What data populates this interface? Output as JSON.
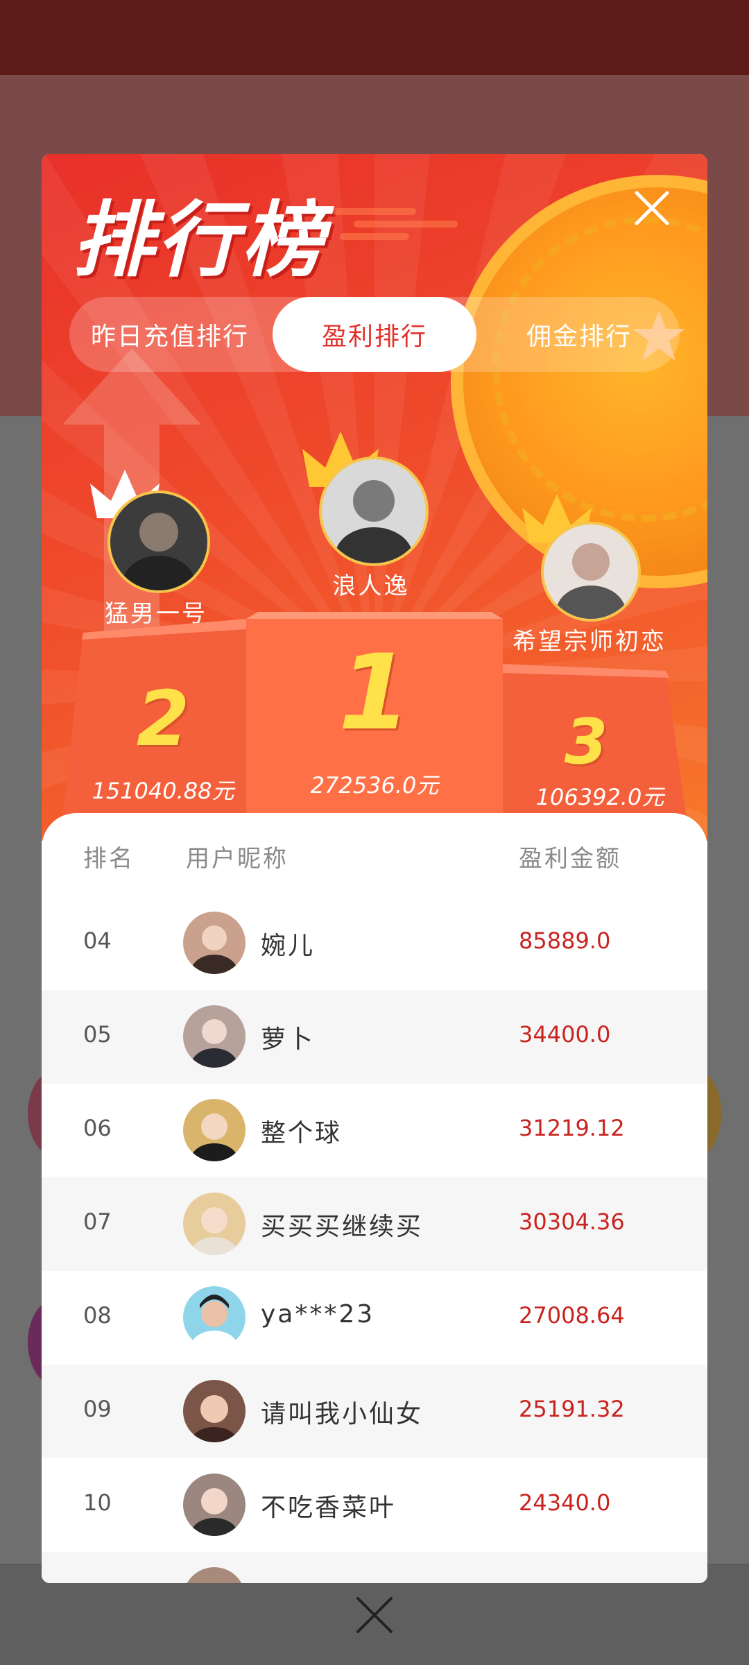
{
  "background_app": {
    "top_bar_color": "#5e1a18",
    "close_icon": "close-icon"
  },
  "modal": {
    "title": "排行榜",
    "close_icon": "close-icon",
    "tabs": [
      {
        "label": "昨日充值排行",
        "active": false
      },
      {
        "label": "盈利排行",
        "active": true
      },
      {
        "label": "佣金排行",
        "active": false
      }
    ],
    "podium": [
      {
        "rank": "1",
        "name": "浪人逸",
        "amount": "272536.0元"
      },
      {
        "rank": "2",
        "name": "猛男一号",
        "amount": "151040.88元"
      },
      {
        "rank": "3",
        "name": "希望宗师初恋",
        "amount": "106392.0元"
      }
    ],
    "list_header": {
      "rank": "排名",
      "nickname": "用户昵称",
      "amount": "盈利金额"
    },
    "rows": [
      {
        "rank": "04",
        "nickname": "婉儿",
        "amount": "85889.0",
        "avatar_color": "#caa18c"
      },
      {
        "rank": "05",
        "nickname": "萝卜",
        "amount": "34400.0",
        "avatar_color": "#b7a29b"
      },
      {
        "rank": "06",
        "nickname": "整个球",
        "amount": "31219.12",
        "avatar_color": "#d8b56a"
      },
      {
        "rank": "07",
        "nickname": "买买买继续买",
        "amount": "30304.36",
        "avatar_color": "#e7cd9c"
      },
      {
        "rank": "08",
        "nickname": "ya***23",
        "amount": "27008.64",
        "avatar_color": "#8fd5ea"
      },
      {
        "rank": "09",
        "nickname": "请叫我小仙女",
        "amount": "25191.32",
        "avatar_color": "#7a5548"
      },
      {
        "rank": "10",
        "nickname": "不吃香菜叶",
        "amount": "24340.0",
        "avatar_color": "#9b8680"
      }
    ]
  },
  "colors": {
    "accent_red": "#e2312a",
    "amount_red": "#c9231f",
    "gold": "#ffe24a"
  }
}
